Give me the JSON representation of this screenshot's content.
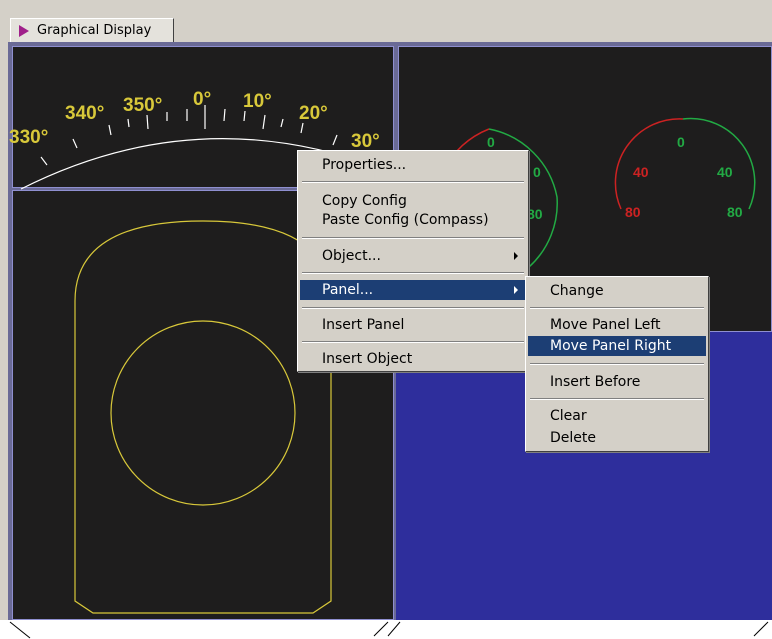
{
  "tab": {
    "label": "Graphical Display"
  },
  "compass": {
    "heading_labels": [
      "330°",
      "340°",
      "350°",
      "0°",
      "10°",
      "20°",
      "30°"
    ],
    "color": "#d8c83a"
  },
  "gauges": [
    {
      "top_label": "0",
      "left_label": "",
      "right_label": "0",
      "bottom_label": "80"
    },
    {
      "top_label": "0",
      "left_label": "40",
      "right_label": "40",
      "left_bottom_label": "80",
      "right_bottom_label": "80"
    }
  ],
  "context_menu": {
    "properties": "Properties...",
    "copy_config": "Copy Config",
    "paste_config": "Paste Config (Compass)",
    "object": "Object...",
    "panel": "Panel...",
    "insert_panel": "Insert Panel",
    "insert_object": "Insert Object"
  },
  "submenu": {
    "change": "Change",
    "move_left": "Move Panel Left",
    "move_right": "Move Panel Right",
    "insert_before": "Insert Before",
    "clear": "Clear",
    "delete": "Delete"
  },
  "colors": {
    "gauge_red": "#cc2222",
    "gauge_green": "#22aa44",
    "highlight": "#1c3e74",
    "blue_panel": "#2e2e9c"
  }
}
